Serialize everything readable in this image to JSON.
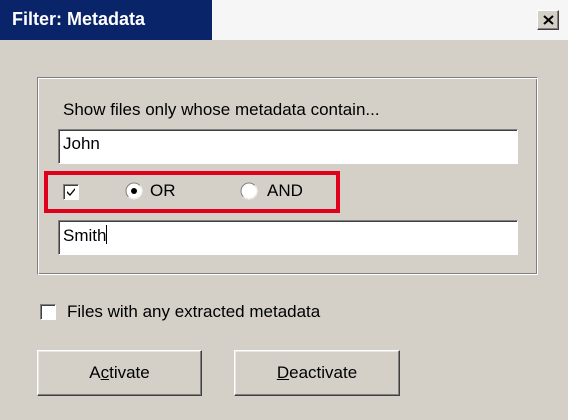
{
  "window": {
    "title": "Filter: Metadata",
    "accent_color": "#0a246a",
    "close_icon": "close-icon"
  },
  "filter": {
    "prompt": "Show files only whose metadata contain...",
    "term1": "John",
    "combine_enabled": true,
    "operator_options": [
      "OR",
      "AND"
    ],
    "operator_selected": "OR",
    "term2": "Smith",
    "highlight_color": "#e0001b"
  },
  "any_metadata": {
    "label": "Files with any extracted metadata",
    "checked": false
  },
  "buttons": {
    "activate": {
      "pre": "A",
      "accel": "c",
      "post": "tivate"
    },
    "deactivate": {
      "pre": "",
      "accel": "D",
      "post": "eactivate"
    }
  }
}
